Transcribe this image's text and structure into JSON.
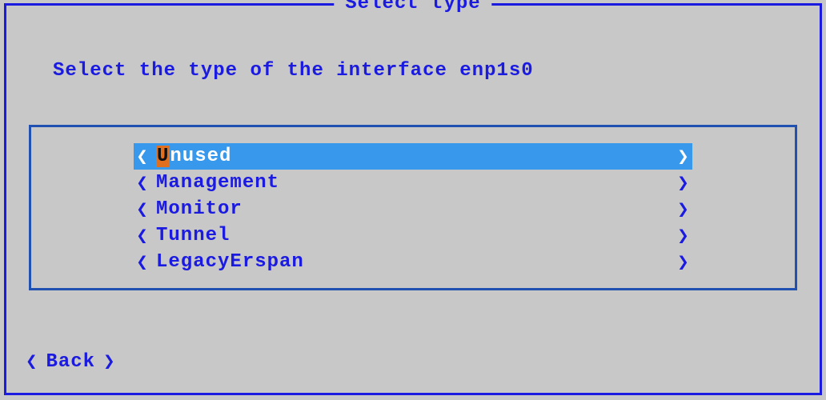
{
  "dialog": {
    "title": "Select type",
    "prompt": "Select the type of the interface enp1s0"
  },
  "options": {
    "unused_first": "U",
    "unused_rest": "nused",
    "management": "Management",
    "monitor": "Monitor",
    "tunnel": "Tunnel",
    "legacyerspan": "LegacyErspan"
  },
  "chevrons": {
    "left": "❮",
    "right": "❯"
  },
  "buttons": {
    "back": "Back"
  }
}
